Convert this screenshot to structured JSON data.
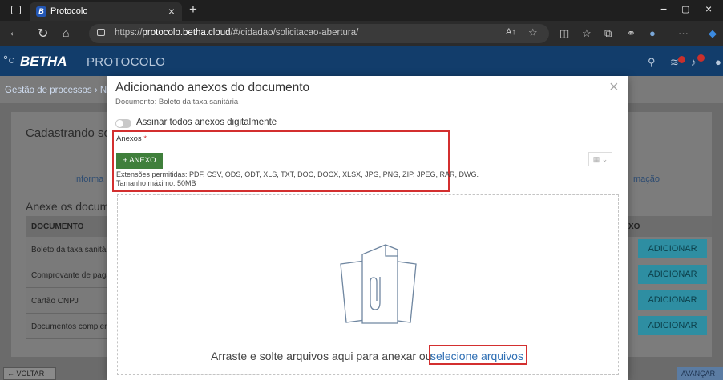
{
  "browser": {
    "tab_title": "Protocolo",
    "tab_favicon": "B",
    "url_prefix": "https://",
    "url_domain": "protocolo.betha.cloud",
    "url_path": "/#/cidadao/solicitacao-abertura/"
  },
  "app": {
    "brand": "BETHA",
    "product": "PROTOCOLO"
  },
  "background": {
    "breadcrumb": "Gestão de processos  ›  N",
    "card_title": "Cadastrando soli",
    "step_left": "Informa",
    "step_right": "mação",
    "section_title": "Anexe os docum",
    "table_header_left": "DOCUMENTO",
    "table_header_right": "XO",
    "rows": [
      "Boleto da taxa sanitár",
      "Comprovante de paga",
      "Cartão CNPJ",
      "Documentos complen"
    ],
    "add_button": "ADICIONAR",
    "back_button": "VOLTAR",
    "next_button": "AVANÇAR"
  },
  "modal": {
    "title": "Adicionando anexos do documento",
    "subtitle": "Documento: Boleto da taxa sanitária",
    "toggle_label": "Assinar todos anexos digitalmente",
    "anexos_label": "Anexos",
    "required_mark": "*",
    "add_anexo_button": "+ ANEXO",
    "extensions_text": "Extensões permitidas: PDF, CSV, ODS, ODT, XLS, TXT, DOC, DOCX, XLSX, JPG, PNG, ZIP, JPEG, RAR, DWG.",
    "max_size_text": "Tamanho máximo: 50MB",
    "drop_text": "Arraste e solte arquivos aqui para anexar ou",
    "drop_link": "selecione arquivos"
  },
  "colors": {
    "header": "#123d6b",
    "accent_green": "#3f7f3b",
    "highlight_red": "#d32f2f",
    "link_blue": "#2f6fb4"
  }
}
